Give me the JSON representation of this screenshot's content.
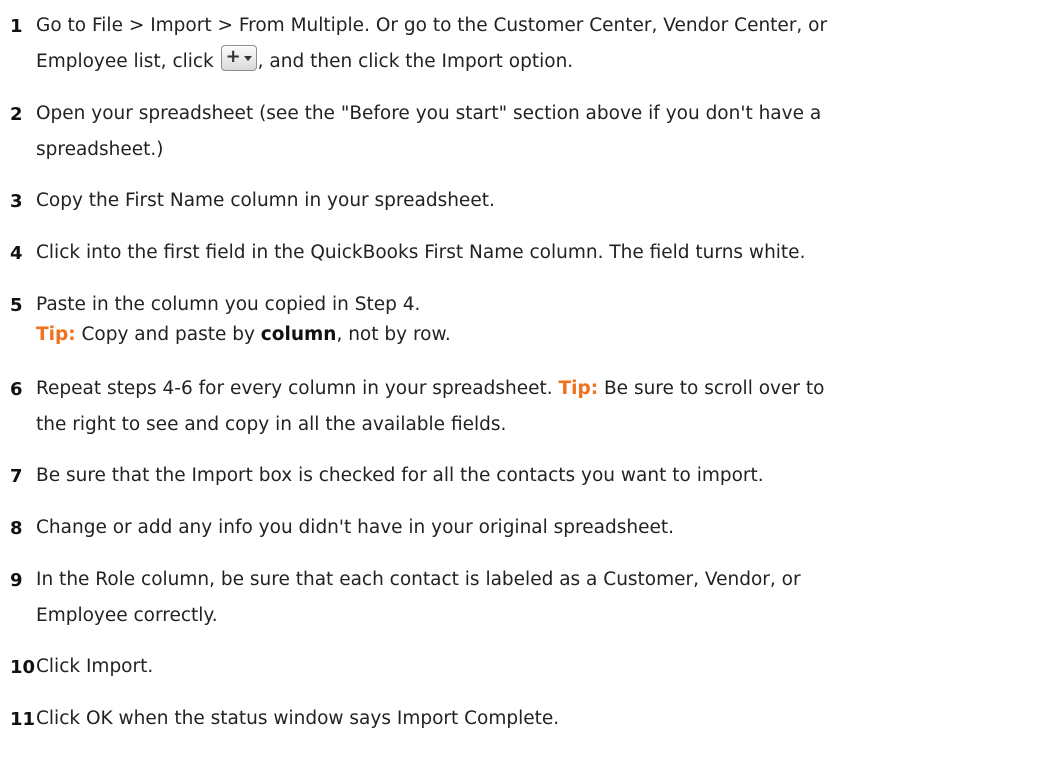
{
  "steps": [
    {
      "num": "1",
      "line1": "Go to File > Import > From Multiple. Or go to the Customer Center, Vendor Center, or",
      "line2_before": "Employee list, click ",
      "line2_after": ", and then click the Import option.",
      "button_icon": "add-dropdown-button-icon",
      "button_plus": "+"
    },
    {
      "num": "2",
      "line1": "Open your spreadsheet (see the \"Before you start\" section above if you don't have a",
      "line2": "spreadsheet.)"
    },
    {
      "num": "3",
      "text": "Copy the First Name column in your spreadsheet."
    },
    {
      "num": "4",
      "text": "Click into the first field in the QuickBooks First Name column. The field turns white."
    },
    {
      "num": "5",
      "text": "Paste in the column you copied in Step 4.",
      "tip_label": "Tip:",
      "tip_before": " Copy and paste by ",
      "tip_bold": "column",
      "tip_after": ", not by row."
    },
    {
      "num": "6",
      "line1_before": "Repeat steps 4-6 for every column in your spreadsheet. ",
      "tip_label": "Tip:",
      "line1_after": " Be sure to scroll over to",
      "line2": "the right to see and copy in all the available fields."
    },
    {
      "num": "7",
      "text": "Be sure that the Import box is checked for all the contacts you want to import."
    },
    {
      "num": "8",
      "text": "Change or add any info you didn't have in your original spreadsheet."
    },
    {
      "num": "9",
      "line1": "In the Role column, be sure that each contact is labeled as a Customer, Vendor, or",
      "line2": "Employee correctly."
    },
    {
      "num": "10",
      "text": "Click Import."
    },
    {
      "num": "11",
      "text": "Click OK when the status window says Import Complete."
    }
  ],
  "colors": {
    "tip": "#f2711c",
    "text": "#222222"
  }
}
